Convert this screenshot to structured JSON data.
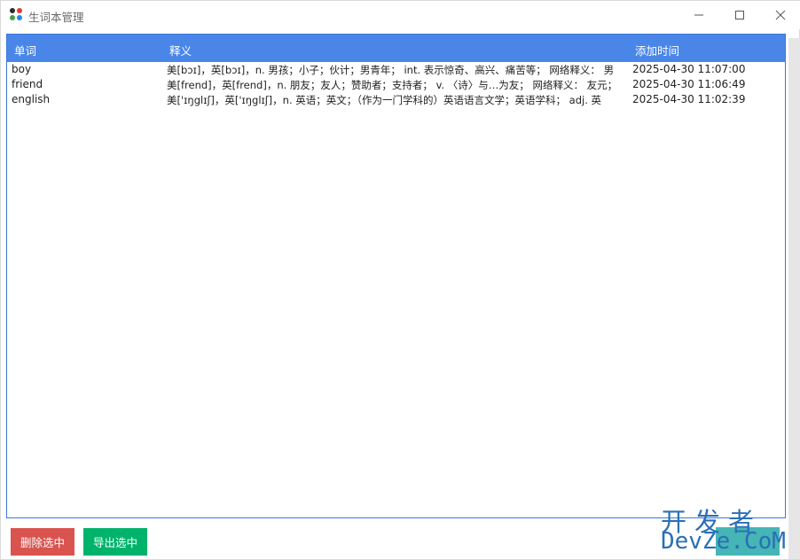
{
  "window": {
    "title": "生词本管理",
    "icon": "app-grid-icon",
    "controls": [
      "minimize-icon",
      "maximize-icon",
      "close-icon"
    ]
  },
  "table": {
    "columns": {
      "word": "单词",
      "definition": "释义",
      "added_time": "添加时间"
    },
    "rows": [
      {
        "word": "boy",
        "definition": "美[bɔɪ]，英[bɔɪ]，n. 男孩；小子；伙计；男青年； int. 表示惊奇、高兴、痛苦等； 网络释义： 男",
        "added_time": "2025-04-30 11:07:00"
      },
      {
        "word": "friend",
        "definition": "美[frend]，英[frend]，n. 朋友；友人；赞助者；支持者； v. 〈诗〉与…为友； 网络释义： 友元；",
        "added_time": "2025-04-30 11:06:49"
      },
      {
        "word": "english",
        "definition": "美['ɪŋglɪʃ]，英['ɪŋglɪʃ]，n. 英语；英文；（作为一门学科的）英语语言文学；英语学科； adj. 英",
        "added_time": "2025-04-30 11:02:39"
      }
    ]
  },
  "buttons": {
    "delete": "删除选中",
    "export": "导出选中"
  },
  "watermark": {
    "line1": "开发者",
    "line2": "DevZe.CoM"
  },
  "colors": {
    "header_bg": "#4a86e8",
    "delete_btn": "#d9534f",
    "export_btn": "#00b36b",
    "watermark": "#2a6fb6"
  }
}
